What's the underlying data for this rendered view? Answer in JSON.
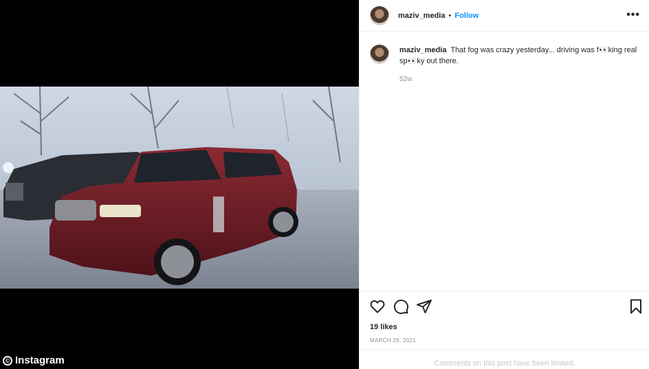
{
  "post": {
    "username": "maziv_media",
    "follow_label": "Follow",
    "dot": "•",
    "more_label": "•••",
    "caption": "That fog was crazy yesterday... driving was f👀king real sp👀ky out there.",
    "age": "52w",
    "likes": "19 likes",
    "date": "MARCH 29, 2021",
    "comments_limited": "Comments on this post have been limited."
  },
  "watermark": {
    "symbol": "©",
    "label": "Instagram"
  },
  "colors": {
    "accent": "#0095f6",
    "muted": "#8e8e8e",
    "border": "#efefef",
    "car_red": "#6b1a22"
  },
  "icons": [
    "heart-icon",
    "comment-icon",
    "share-icon",
    "bookmark-icon"
  ]
}
